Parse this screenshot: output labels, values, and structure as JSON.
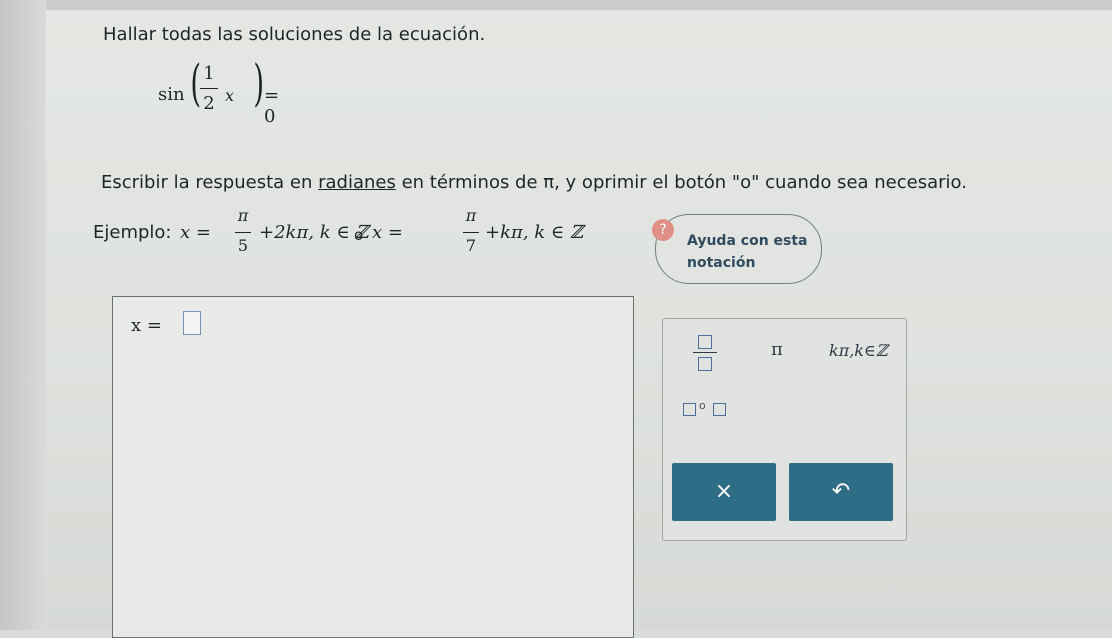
{
  "question": {
    "prompt": "Hallar todas las soluciones de la ecuación.",
    "equation": {
      "func": "sin",
      "frac_num": "1",
      "frac_den": "2",
      "variable": "x",
      "rhs": "= 0"
    },
    "instruction_before": "Escribir la respuesta en ",
    "instruction_link": "radianes",
    "instruction_after": " en términos de π, y oprimir el botón \"o\" cuando sea necesario."
  },
  "example": {
    "label": "Ejemplo:",
    "x_eq_1": "x =",
    "frac1_num": "π",
    "frac1_den": "5",
    "term1": "+2kπ, k ∈ ℤ",
    "or_word": "o",
    "x_eq_2": "x =",
    "frac2_num": "π",
    "frac2_den": "7",
    "term2": "+kπ, k ∈ ℤ"
  },
  "help": {
    "icon": "?",
    "label": "Ayuda con esta notación"
  },
  "answer": {
    "lhs": "x ="
  },
  "keypad": {
    "pi_key": "π",
    "kpi_key": "kπ,k∈ℤ",
    "or_symbol": "o",
    "clear_label": "×",
    "undo_label": "↶"
  },
  "colors": {
    "button_teal": "#2e6d86",
    "slot_border": "#7b93b3",
    "help_icon": "#e08f86"
  }
}
